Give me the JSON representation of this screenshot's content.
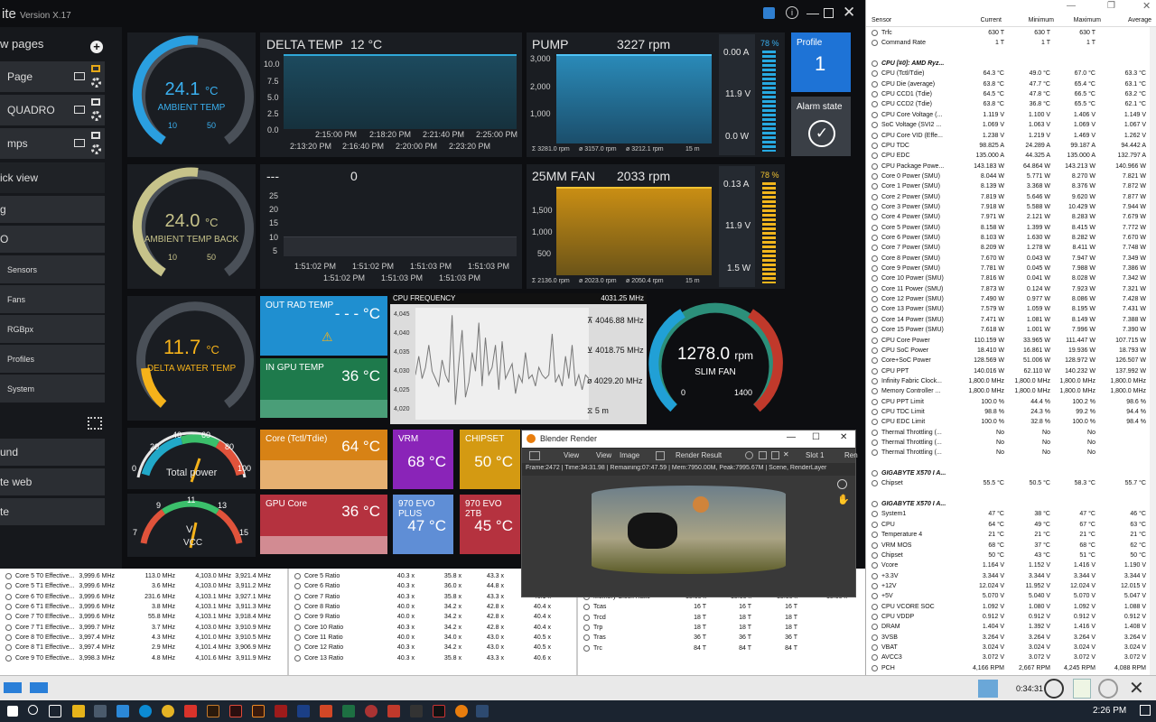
{
  "app": {
    "title_fragment": "ite",
    "version": "Version X.17"
  },
  "sidebar": {
    "new_pages": "w pages",
    "pages": [
      {
        "label": "Page"
      },
      {
        "label": "QUADRO"
      },
      {
        "label": "mps"
      }
    ],
    "quick_view": "ick view",
    "items": [
      "Sensors",
      "Fans",
      "RGBpx",
      "Profiles",
      "System"
    ],
    "bottom": [
      "und",
      "te web",
      "te"
    ]
  },
  "ambient": {
    "value": "24.1",
    "unit": "°C",
    "label": "AMBIENT TEMP",
    "min": "10",
    "max": "50"
  },
  "ambient_back": {
    "value": "24.0",
    "unit": "°C",
    "label": "AMBIENT TEMP BACK",
    "min": "10",
    "max": "50"
  },
  "delta_water": {
    "value": "11.7",
    "unit": "°C",
    "label": "DELTA WATER TEMP"
  },
  "delta_temp": {
    "title": "DELTA TEMP",
    "value": "12 °C",
    "y_ticks": [
      "10.0",
      "7.5",
      "5.0",
      "2.5",
      "0.0"
    ],
    "x_top": [
      "2:15:00 PM",
      "2:18:20 PM",
      "2:21:40 PM",
      "2:25:00 PM"
    ],
    "x_bottom": [
      "2:13:20 PM",
      "2:16:40 PM",
      "2:20:00 PM",
      "2:23:20 PM"
    ]
  },
  "pump": {
    "title": "PUMP",
    "value": "3227 rpm",
    "y_ticks": [
      "3,000",
      "2,000",
      "1,000"
    ],
    "footer": [
      "Ʃ 3281.0 rpm",
      "ø 3157.0 rpm",
      "ø 3212.1 rpm",
      "15 m"
    ],
    "amps": "0.00 A",
    "volts": "11.9 V",
    "watts": "0.0 W",
    "percent": "78 %"
  },
  "graph3": {
    "title": "---",
    "value": "0",
    "y_ticks": [
      "25",
      "20",
      "15",
      "10",
      "5"
    ],
    "x_top": [
      "1:51:02 PM",
      "1:51:02 PM",
      "1:51:03 PM",
      "1:51:03 PM"
    ],
    "x_bottom": [
      "1:51:02 PM",
      "1:51:02 PM",
      "1:51:03 PM",
      "1:51:03 PM"
    ]
  },
  "fan25": {
    "title": "25MM FAN",
    "value": "2033 rpm",
    "y_ticks": [
      "1,500",
      "1,000",
      "500"
    ],
    "footer": [
      "Ʃ 2136.0 rpm",
      "ø 2023.0 rpm",
      "ø 2050.4 rpm",
      "15 m"
    ],
    "amps": "0.13 A",
    "volts": "11.9 V",
    "watts": "1.5 W",
    "percent": "78 %"
  },
  "profile": {
    "label": "Profile",
    "value": "1"
  },
  "alarm": {
    "label": "Alarm state"
  },
  "out_rad": {
    "title": "OUT RAD TEMP",
    "value": "- - - °C"
  },
  "in_gpu": {
    "title": "IN GPU TEMP",
    "value": "36 °C"
  },
  "cpu_freq": {
    "title": "CPU FREQUENCY",
    "value": "4031.25 MHz",
    "y_ticks": [
      "4,045",
      "4,040",
      "4,035",
      "4,030",
      "4,025",
      "4,020"
    ],
    "max": "4046.88 MHz",
    "min": "4018.75 MHz",
    "avg": "4029.20 MHz",
    "span": "5 m"
  },
  "slim_fan": {
    "value": "1278.0",
    "unit": "rpm",
    "label": "SLIM FAN",
    "min": "0",
    "max": "1400"
  },
  "power": {
    "label": "Total power",
    "ticks": [
      "0",
      "20",
      "40",
      "60",
      "80",
      "100"
    ]
  },
  "vcc": {
    "label": "VCC",
    "unit": "V",
    "ticks": [
      "9",
      "11",
      "13",
      "15",
      "7"
    ]
  },
  "tiles": {
    "core": {
      "title": "Core (Tctl/Tdie)",
      "value": "64 °C"
    },
    "vrm": {
      "title": "VRM",
      "value": "68 °C"
    },
    "chipset": {
      "title": "CHIPSET",
      "value": "50 °C"
    },
    "gpu_core": {
      "title": "GPU Core",
      "value": "36 °C"
    },
    "evo_plus": {
      "title": "970 EVO PLUS",
      "value": "47 °C"
    },
    "evo_2tb": {
      "title": "970 EVO 2TB",
      "value": "45 °C"
    }
  },
  "blender": {
    "title": "Blender Render",
    "menu": [
      "View",
      "View",
      "Image",
      "Render Result",
      "Slot 1",
      "Ren"
    ],
    "status": "Frame:2472 | Time:34:31.98 | Remaining:07:47.59 | Mem:7950.00M, Peak:7995.67M | Scene, RenderLayer"
  },
  "hwinfo": {
    "headers": [
      "Sensor",
      "Current",
      "Minimum",
      "Maximum",
      "Average"
    ],
    "rows": [
      [
        "Trfc",
        "630 T",
        "630 T",
        "630 T",
        ""
      ],
      [
        "Command Rate",
        "1 T",
        "1 T",
        "1 T",
        ""
      ],
      [
        "",
        "",
        "",
        "",
        ""
      ],
      [
        "CPU [#0]: AMD Ryz...",
        "",
        "",
        "",
        "",
        "g"
      ],
      [
        "CPU (Tctl/Tdie)",
        "64.3 °C",
        "49.0 °C",
        "67.0 °C",
        "63.3 °C"
      ],
      [
        "CPU Die (average)",
        "63.8 °C",
        "47.7 °C",
        "65.4 °C",
        "63.1 °C"
      ],
      [
        "CPU CCD1 (Tdie)",
        "64.5 °C",
        "47.8 °C",
        "66.5 °C",
        "63.2 °C"
      ],
      [
        "CPU CCD2 (Tdie)",
        "63.8 °C",
        "36.8 °C",
        "65.5 °C",
        "62.1 °C"
      ],
      [
        "CPU Core Voltage (...",
        "1.119 V",
        "1.100 V",
        "1.406 V",
        "1.149 V"
      ],
      [
        "SoC Voltage (SVI2 ...",
        "1.069 V",
        "1.063 V",
        "1.069 V",
        "1.067 V"
      ],
      [
        "CPU Core VID (Effe...",
        "1.238 V",
        "1.219 V",
        "1.469 V",
        "1.262 V"
      ],
      [
        "CPU TDC",
        "98.825 A",
        "24.289 A",
        "99.187 A",
        "94.442 A"
      ],
      [
        "CPU EDC",
        "135.000 A",
        "44.325 A",
        "135.000 A",
        "132.797 A"
      ],
      [
        "CPU Package Powe...",
        "143.183 W",
        "64.864 W",
        "143.213 W",
        "140.966 W"
      ],
      [
        "Core 0 Power (SMU)",
        "8.044 W",
        "5.771 W",
        "8.270 W",
        "7.821 W"
      ],
      [
        "Core 1 Power (SMU)",
        "8.139 W",
        "3.368 W",
        "8.376 W",
        "7.872 W"
      ],
      [
        "Core 2 Power (SMU)",
        "7.819 W",
        "5.646 W",
        "9.620 W",
        "7.877 W"
      ],
      [
        "Core 3 Power (SMU)",
        "7.918 W",
        "5.588 W",
        "10.429 W",
        "7.944 W"
      ],
      [
        "Core 4 Power (SMU)",
        "7.971 W",
        "2.121 W",
        "8.283 W",
        "7.679 W"
      ],
      [
        "Core 5 Power (SMU)",
        "8.158 W",
        "1.399 W",
        "8.415 W",
        "7.772 W"
      ],
      [
        "Core 6 Power (SMU)",
        "8.103 W",
        "1.630 W",
        "8.282 W",
        "7.670 W"
      ],
      [
        "Core 7 Power (SMU)",
        "8.209 W",
        "1.278 W",
        "8.411 W",
        "7.748 W"
      ],
      [
        "Core 8 Power (SMU)",
        "7.670 W",
        "0.043 W",
        "7.947 W",
        "7.349 W"
      ],
      [
        "Core 9 Power (SMU)",
        "7.781 W",
        "0.045 W",
        "7.988 W",
        "7.386 W"
      ],
      [
        "Core 10 Power (SMU)",
        "7.816 W",
        "0.041 W",
        "8.028 W",
        "7.342 W"
      ],
      [
        "Core 11 Power (SMU)",
        "7.873 W",
        "0.124 W",
        "7.923 W",
        "7.321 W"
      ],
      [
        "Core 12 Power (SMU)",
        "7.490 W",
        "0.977 W",
        "8.086 W",
        "7.428 W"
      ],
      [
        "Core 13 Power (SMU)",
        "7.579 W",
        "1.059 W",
        "8.195 W",
        "7.431 W"
      ],
      [
        "Core 14 Power (SMU)",
        "7.471 W",
        "1.081 W",
        "8.149 W",
        "7.388 W"
      ],
      [
        "Core 15 Power (SMU)",
        "7.618 W",
        "1.001 W",
        "7.996 W",
        "7.390 W"
      ],
      [
        "CPU Core Power",
        "110.159 W",
        "33.965 W",
        "111.447 W",
        "107.715 W"
      ],
      [
        "CPU SoC Power",
        "18.410 W",
        "16.861 W",
        "19.936 W",
        "18.793 W"
      ],
      [
        "Core+SoC Power",
        "128.569 W",
        "51.006 W",
        "128.972 W",
        "126.507 W"
      ],
      [
        "CPU PPT",
        "140.016 W",
        "62.110 W",
        "140.232 W",
        "137.992 W"
      ],
      [
        "Infinity Fabric Clock...",
        "1,800.0 MHz",
        "1,800.0 MHz",
        "1,800.0 MHz",
        "1,800.0 MHz"
      ],
      [
        "Memory Controller ...",
        "1,800.0 MHz",
        "1,800.0 MHz",
        "1,800.0 MHz",
        "1,800.0 MHz"
      ],
      [
        "CPU PPT Limit",
        "100.0 %",
        "44.4 %",
        "100.2 %",
        "98.6 %"
      ],
      [
        "CPU TDC Limit",
        "98.8 %",
        "24.3 %",
        "99.2 %",
        "94.4 %"
      ],
      [
        "CPU EDC Limit",
        "100.0 %",
        "32.8 %",
        "100.0 %",
        "98.4 %"
      ],
      [
        "Thermal Throttling (...",
        "No",
        "No",
        "No",
        ""
      ],
      [
        "Thermal Throttling (...",
        "No",
        "No",
        "No",
        ""
      ],
      [
        "Thermal Throttling (...",
        "No",
        "No",
        "No",
        ""
      ],
      [
        "",
        "",
        "",
        "",
        ""
      ],
      [
        "GIGABYTE X570 I A...",
        "",
        "",
        "",
        "",
        "g"
      ],
      [
        "Chipset",
        "55.5 °C",
        "50.5 °C",
        "58.3 °C",
        "55.7 °C"
      ],
      [
        "",
        "",
        "",
        "",
        ""
      ],
      [
        "GIGABYTE X570 I A...",
        "",
        "",
        "",
        "",
        "g"
      ],
      [
        "System1",
        "47 °C",
        "38 °C",
        "47 °C",
        "46 °C"
      ],
      [
        "CPU",
        "64 °C",
        "49 °C",
        "67 °C",
        "63 °C"
      ],
      [
        "Temperature 4",
        "21 °C",
        "21 °C",
        "21 °C",
        "21 °C"
      ],
      [
        "VRM MOS",
        "68 °C",
        "37 °C",
        "68 °C",
        "62 °C"
      ],
      [
        "Chipset",
        "50 °C",
        "43 °C",
        "51 °C",
        "50 °C"
      ],
      [
        "Vcore",
        "1.164 V",
        "1.152 V",
        "1.416 V",
        "1.190 V"
      ],
      [
        "+3.3V",
        "3.344 V",
        "3.344 V",
        "3.344 V",
        "3.344 V"
      ],
      [
        "+12V",
        "12.024 V",
        "11.952 V",
        "12.024 V",
        "12.015 V"
      ],
      [
        "+5V",
        "5.070 V",
        "5.040 V",
        "5.070 V",
        "5.047 V"
      ],
      [
        "CPU VCORE SOC",
        "1.092 V",
        "1.080 V",
        "1.092 V",
        "1.088 V"
      ],
      [
        "CPU VDDP",
        "0.912 V",
        "0.912 V",
        "0.912 V",
        "0.912 V"
      ],
      [
        "DRAM",
        "1.404 V",
        "1.392 V",
        "1.416 V",
        "1.408 V"
      ],
      [
        "3VSB",
        "3.264 V",
        "3.264 V",
        "3.264 V",
        "3.264 V"
      ],
      [
        "VBAT",
        "3.024 V",
        "3.024 V",
        "3.024 V",
        "3.024 V"
      ],
      [
        "AVCC3",
        "3.072 V",
        "3.072 V",
        "3.072 V",
        "3.072 V"
      ],
      [
        "PCH",
        "4,166 RPM",
        "2,667 RPM",
        "4,245 RPM",
        "4,088 RPM"
      ]
    ]
  },
  "bottom_left": [
    [
      "Core 5 T0 Effective...",
      "3,999.6 MHz",
      "113.0 MHz",
      "4,103.0 MHz",
      "3,921.4 MHz"
    ],
    [
      "Core 5 T1 Effective...",
      "3,999.6 MHz",
      "3.6 MHz",
      "4,103.0 MHz",
      "3,911.2 MHz"
    ],
    [
      "Core 6 T0 Effective...",
      "3,999.6 MHz",
      "231.6 MHz",
      "4,103.1 MHz",
      "3,927.1 MHz"
    ],
    [
      "Core 6 T1 Effective...",
      "3,999.6 MHz",
      "3.8 MHz",
      "4,103.1 MHz",
      "3,911.3 MHz"
    ],
    [
      "Core 7 T0 Effective...",
      "3,999.6 MHz",
      "55.8 MHz",
      "4,103.1 MHz",
      "3,918.4 MHz"
    ],
    [
      "Core 7 T1 Effective...",
      "3,999.7 MHz",
      "3.7 MHz",
      "4,103.0 MHz",
      "3,910.9 MHz"
    ],
    [
      "Core 8 T0 Effective...",
      "3,997.4 MHz",
      "4.3 MHz",
      "4,101.0 MHz",
      "3,910.5 MHz"
    ],
    [
      "Core 8 T1 Effective...",
      "3,997.4 MHz",
      "2.9 MHz",
      "4,101.4 MHz",
      "3,906.9 MHz"
    ],
    [
      "Core 9 T0 Effective...",
      "3,998.3 MHz",
      "4.8 MHz",
      "4,101.6 MHz",
      "3,911.9 MHz"
    ]
  ],
  "bottom_mid": [
    [
      "Core 5 Ratio",
      "40.3 x",
      "35.8 x",
      "43.3 x",
      "40.1 x"
    ],
    [
      "Core 6 Ratio",
      "40.3 x",
      "36.0 x",
      "44.8 x",
      "40.5 x"
    ],
    [
      "Core 7 Ratio",
      "40.3 x",
      "35.8 x",
      "43.3 x",
      "40.1 x"
    ],
    [
      "Core 8 Ratio",
      "40.0 x",
      "34.2 x",
      "42.8 x",
      "40.4 x"
    ],
    [
      "Core 9 Ratio",
      "40.0 x",
      "34.2 x",
      "42.8 x",
      "40.4 x"
    ],
    [
      "Core 10 Ratio",
      "40.3 x",
      "34.2 x",
      "42.8 x",
      "40.4 x"
    ],
    [
      "Core 11 Ratio",
      "40.0 x",
      "34.0 x",
      "43.0 x",
      "40.5 x"
    ],
    [
      "Core 12 Ratio",
      "40.3 x",
      "34.2 x",
      "43.0 x",
      "40.5 x"
    ],
    [
      "Core 13 Ratio",
      "40.3 x",
      "35.8 x",
      "43.3 x",
      "40.6 x"
    ]
  ],
  "bottom_right": [
    [
      "Memory Clock Ratio",
      "18.00 x",
      "18.00 x",
      "18.00 x",
      "18.00 x"
    ],
    [
      "Tcas",
      "16 T",
      "16 T",
      "16 T",
      ""
    ],
    [
      "Trcd",
      "18 T",
      "18 T",
      "18 T",
      ""
    ],
    [
      "Trp",
      "18 T",
      "18 T",
      "18 T",
      ""
    ],
    [
      "Tras",
      "36 T",
      "36 T",
      "36 T",
      ""
    ],
    [
      "Trc",
      "84 T",
      "84 T",
      "84 T",
      ""
    ]
  ],
  "status": {
    "elapsed": "0:34:31",
    "clock": "2:26 PM"
  }
}
